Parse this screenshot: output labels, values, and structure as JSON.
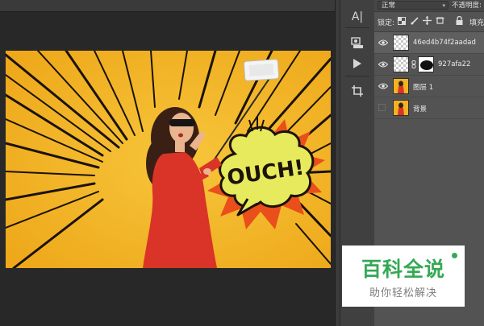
{
  "layers_panel": {
    "blend_mode": "正常",
    "opacity_label": "不透明度:",
    "lock_label": "锁定:",
    "fill_label": "填充:",
    "layers": [
      {
        "name": "46ed4b74f2aadad",
        "visible": true,
        "thumb": "checker-smart",
        "active": true
      },
      {
        "name": "927afa22",
        "visible": true,
        "thumb": "checker-with-mask",
        "active": false
      },
      {
        "name": "图层 1",
        "visible": true,
        "thumb": "photo",
        "active": false
      },
      {
        "name": "背景",
        "visible": false,
        "thumb": "photo",
        "active": false
      }
    ]
  },
  "toolbar": {
    "tools": [
      "character-panel-icon",
      "paragraph-panel-icon",
      "play-action-icon",
      "crop-icon"
    ],
    "character_glyph": "A|"
  },
  "canvas": {
    "speech_bubble_text": "OUCH!",
    "background_color": "#f2b322",
    "bubble_color": "#e6ea5c",
    "burst_color": "#e94e1b",
    "dress_color": "#d93427"
  },
  "watermark": {
    "title": "百科全说",
    "subtitle": "助你轻松解决",
    "color": "#35a853"
  }
}
